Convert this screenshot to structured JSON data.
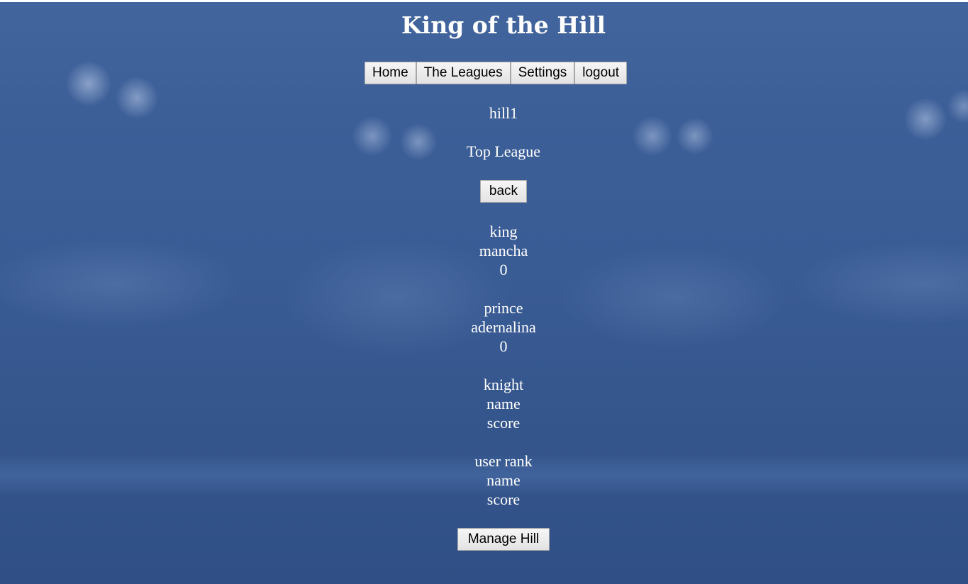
{
  "header": {
    "title": "King of the Hill"
  },
  "nav": {
    "items": [
      {
        "label": "Home"
      },
      {
        "label": "The Leagues"
      },
      {
        "label": "Settings"
      },
      {
        "label": "logout"
      }
    ]
  },
  "hill": {
    "name": "hill1",
    "league": "Top League",
    "back_label": "back"
  },
  "ranks": [
    {
      "rank": "king",
      "name": "mancha",
      "score": "0"
    },
    {
      "rank": "prince",
      "name": "adernalina",
      "score": "0"
    },
    {
      "rank": "knight",
      "name": "name",
      "score": "score"
    },
    {
      "rank": "user rank",
      "name": "name",
      "score": "score"
    }
  ],
  "actions": {
    "manage_label": "Manage Hill"
  },
  "colors": {
    "background": "#3a5c95",
    "text": "#ffffff",
    "button_bg": "#efefef"
  }
}
